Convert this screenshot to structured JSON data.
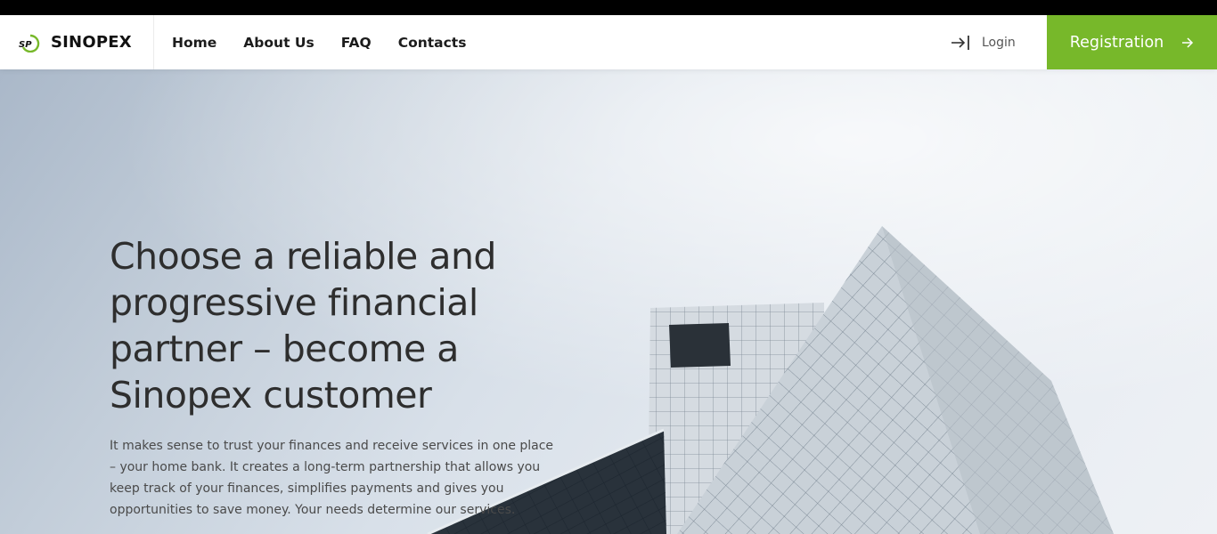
{
  "brand": {
    "name": "SINOPEX",
    "logo_text": "SP"
  },
  "nav": {
    "items": [
      "Home",
      "About Us",
      "FAQ",
      "Contacts"
    ]
  },
  "login": {
    "label": "Login"
  },
  "registration": {
    "label": "Registration"
  },
  "hero": {
    "title": "Choose a reliable and progressive financial partner – become a Sinopex customer",
    "text": "It makes sense to trust your finances and receive services in one place – your home bank. It creates a long-term partnership that allows you keep track of your finances, simplifies payments and gives you opportunities to save money. Your needs determine our services."
  },
  "colors": {
    "accent": "#77b82a",
    "topbar": "#000000",
    "text": "#2e2e2e"
  }
}
